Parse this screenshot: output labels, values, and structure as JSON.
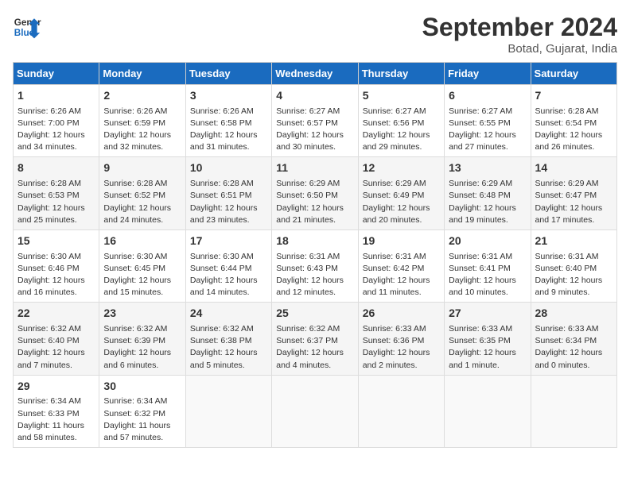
{
  "header": {
    "logo_line1": "General",
    "logo_line2": "Blue",
    "month": "September 2024",
    "location": "Botad, Gujarat, India"
  },
  "days_of_week": [
    "Sunday",
    "Monday",
    "Tuesday",
    "Wednesday",
    "Thursday",
    "Friday",
    "Saturday"
  ],
  "weeks": [
    [
      {
        "day": "1",
        "info": "Sunrise: 6:26 AM\nSunset: 7:00 PM\nDaylight: 12 hours\nand 34 minutes."
      },
      {
        "day": "2",
        "info": "Sunrise: 6:26 AM\nSunset: 6:59 PM\nDaylight: 12 hours\nand 32 minutes."
      },
      {
        "day": "3",
        "info": "Sunrise: 6:26 AM\nSunset: 6:58 PM\nDaylight: 12 hours\nand 31 minutes."
      },
      {
        "day": "4",
        "info": "Sunrise: 6:27 AM\nSunset: 6:57 PM\nDaylight: 12 hours\nand 30 minutes."
      },
      {
        "day": "5",
        "info": "Sunrise: 6:27 AM\nSunset: 6:56 PM\nDaylight: 12 hours\nand 29 minutes."
      },
      {
        "day": "6",
        "info": "Sunrise: 6:27 AM\nSunset: 6:55 PM\nDaylight: 12 hours\nand 27 minutes."
      },
      {
        "day": "7",
        "info": "Sunrise: 6:28 AM\nSunset: 6:54 PM\nDaylight: 12 hours\nand 26 minutes."
      }
    ],
    [
      {
        "day": "8",
        "info": "Sunrise: 6:28 AM\nSunset: 6:53 PM\nDaylight: 12 hours\nand 25 minutes."
      },
      {
        "day": "9",
        "info": "Sunrise: 6:28 AM\nSunset: 6:52 PM\nDaylight: 12 hours\nand 24 minutes."
      },
      {
        "day": "10",
        "info": "Sunrise: 6:28 AM\nSunset: 6:51 PM\nDaylight: 12 hours\nand 23 minutes."
      },
      {
        "day": "11",
        "info": "Sunrise: 6:29 AM\nSunset: 6:50 PM\nDaylight: 12 hours\nand 21 minutes."
      },
      {
        "day": "12",
        "info": "Sunrise: 6:29 AM\nSunset: 6:49 PM\nDaylight: 12 hours\nand 20 minutes."
      },
      {
        "day": "13",
        "info": "Sunrise: 6:29 AM\nSunset: 6:48 PM\nDaylight: 12 hours\nand 19 minutes."
      },
      {
        "day": "14",
        "info": "Sunrise: 6:29 AM\nSunset: 6:47 PM\nDaylight: 12 hours\nand 17 minutes."
      }
    ],
    [
      {
        "day": "15",
        "info": "Sunrise: 6:30 AM\nSunset: 6:46 PM\nDaylight: 12 hours\nand 16 minutes."
      },
      {
        "day": "16",
        "info": "Sunrise: 6:30 AM\nSunset: 6:45 PM\nDaylight: 12 hours\nand 15 minutes."
      },
      {
        "day": "17",
        "info": "Sunrise: 6:30 AM\nSunset: 6:44 PM\nDaylight: 12 hours\nand 14 minutes."
      },
      {
        "day": "18",
        "info": "Sunrise: 6:31 AM\nSunset: 6:43 PM\nDaylight: 12 hours\nand 12 minutes."
      },
      {
        "day": "19",
        "info": "Sunrise: 6:31 AM\nSunset: 6:42 PM\nDaylight: 12 hours\nand 11 minutes."
      },
      {
        "day": "20",
        "info": "Sunrise: 6:31 AM\nSunset: 6:41 PM\nDaylight: 12 hours\nand 10 minutes."
      },
      {
        "day": "21",
        "info": "Sunrise: 6:31 AM\nSunset: 6:40 PM\nDaylight: 12 hours\nand 9 minutes."
      }
    ],
    [
      {
        "day": "22",
        "info": "Sunrise: 6:32 AM\nSunset: 6:40 PM\nDaylight: 12 hours\nand 7 minutes."
      },
      {
        "day": "23",
        "info": "Sunrise: 6:32 AM\nSunset: 6:39 PM\nDaylight: 12 hours\nand 6 minutes."
      },
      {
        "day": "24",
        "info": "Sunrise: 6:32 AM\nSunset: 6:38 PM\nDaylight: 12 hours\nand 5 minutes."
      },
      {
        "day": "25",
        "info": "Sunrise: 6:32 AM\nSunset: 6:37 PM\nDaylight: 12 hours\nand 4 minutes."
      },
      {
        "day": "26",
        "info": "Sunrise: 6:33 AM\nSunset: 6:36 PM\nDaylight: 12 hours\nand 2 minutes."
      },
      {
        "day": "27",
        "info": "Sunrise: 6:33 AM\nSunset: 6:35 PM\nDaylight: 12 hours\nand 1 minute."
      },
      {
        "day": "28",
        "info": "Sunrise: 6:33 AM\nSunset: 6:34 PM\nDaylight: 12 hours\nand 0 minutes."
      }
    ],
    [
      {
        "day": "29",
        "info": "Sunrise: 6:34 AM\nSunset: 6:33 PM\nDaylight: 11 hours\nand 58 minutes."
      },
      {
        "day": "30",
        "info": "Sunrise: 6:34 AM\nSunset: 6:32 PM\nDaylight: 11 hours\nand 57 minutes."
      },
      {
        "day": "",
        "info": ""
      },
      {
        "day": "",
        "info": ""
      },
      {
        "day": "",
        "info": ""
      },
      {
        "day": "",
        "info": ""
      },
      {
        "day": "",
        "info": ""
      }
    ]
  ]
}
